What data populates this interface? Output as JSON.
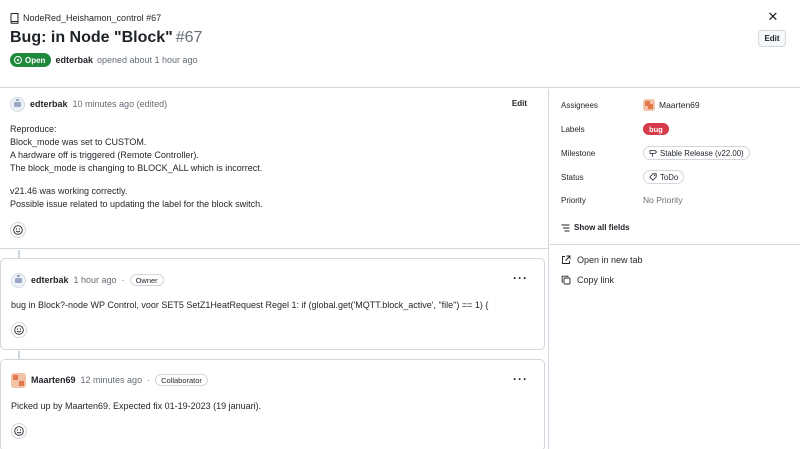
{
  "header": {
    "repo_label": "NodeRed_Heishamon_control #67",
    "title": "Bug: in Node \"Block\"",
    "number": "#67",
    "edit_label": "Edit",
    "state_label": "Open",
    "author": "edterbak",
    "opened_text": "opened about 1 hour ago"
  },
  "comments": [
    {
      "author": "edterbak",
      "time": "10 minutes ago (edited)",
      "edit_label": "Edit",
      "lines": [
        "Reproduce:",
        "Block_mode was set to CUSTOM.",
        "A hardware off is triggered (Remote Controller).",
        "The block_mode is changing to BLOCK_ALL which is incorrect.",
        "v21.46 was working correctly.",
        "Possible issue related to updating the label for the block switch."
      ]
    },
    {
      "author": "edterbak",
      "time": "1 hour ago",
      "separator": "·",
      "role": "Owner",
      "menu": "···",
      "text": "bug in Block?-node WP Control, voor SET5 SetZ1HeatRequest Regel 1: if (global.get('MQTT.block_active', \"file\") == 1) {"
    },
    {
      "author": "Maarten69",
      "time": "12 minutes ago",
      "separator": "·",
      "role": "Collaborator",
      "menu": "···",
      "text": "Picked up by Maarten69. Expected fix 01-19-2023 (19 januari)."
    }
  ],
  "sidebar": {
    "assignees_label": "Assignees",
    "assignee": "Maarten69",
    "labels_label": "Labels",
    "label_bug": "bug",
    "milestone_label": "Milestone",
    "milestone": "Stable Release (v22.00)",
    "status_label": "Status",
    "status": "ToDo",
    "priority_label": "Priority",
    "priority": "No Priority",
    "show_all": "Show all fields",
    "open_new_tab": "Open in new tab",
    "copy_link": "Copy link"
  },
  "colors": {
    "open_green": "#1f883d",
    "bug_red": "#d73a4a",
    "border": "#d0d7de",
    "muted_text": "#656d76"
  }
}
